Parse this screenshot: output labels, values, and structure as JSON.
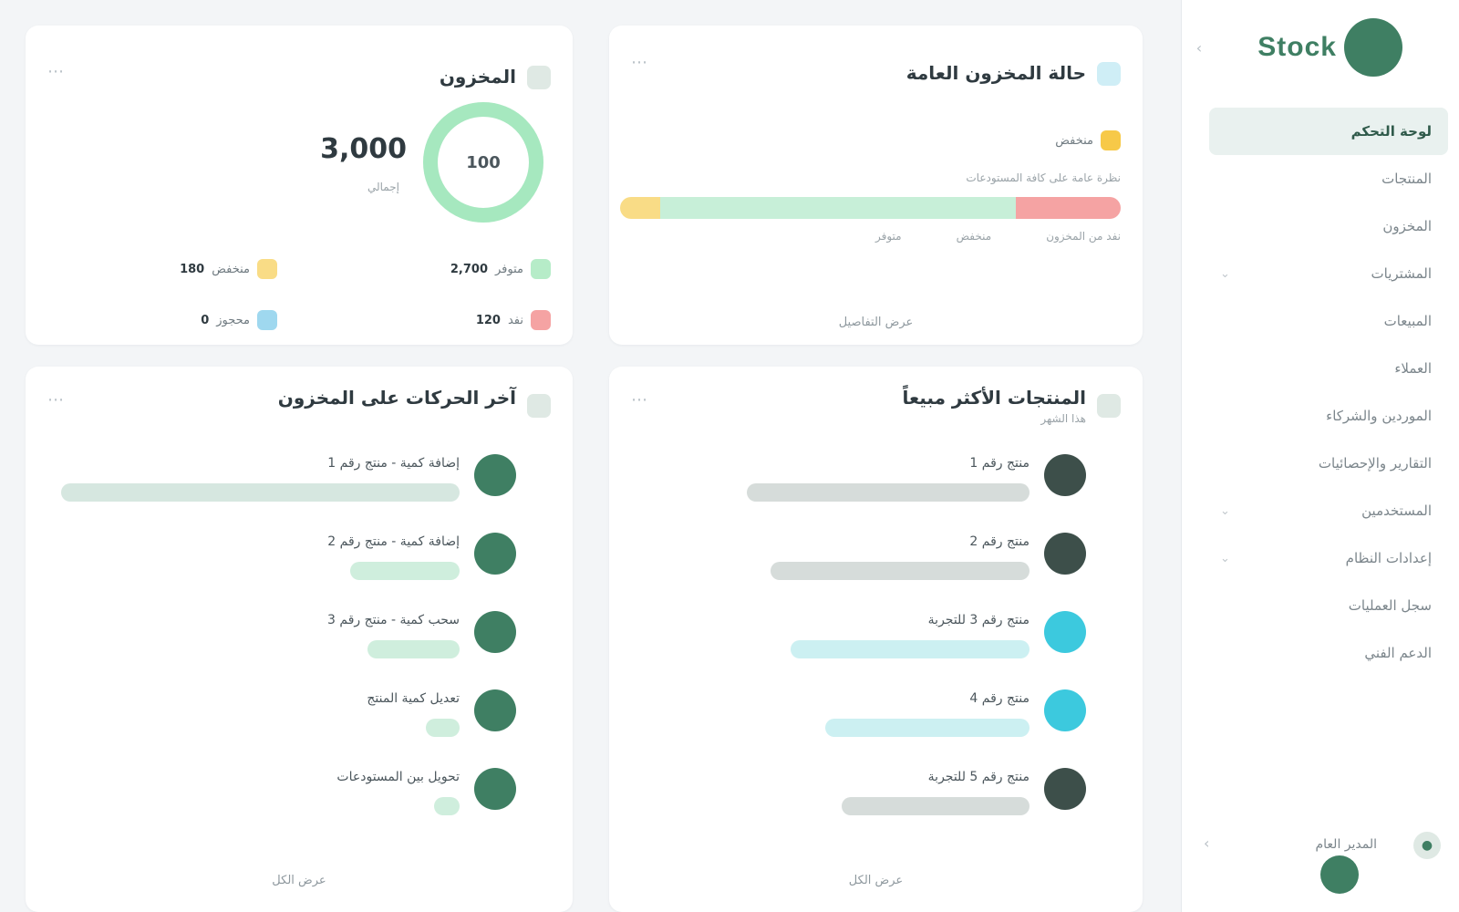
{
  "brand": {
    "name": "Stock"
  },
  "sidebar": {
    "items": [
      {
        "label": "لوحة التحكم"
      },
      {
        "label": "المنتجات"
      },
      {
        "label": "المخزون"
      },
      {
        "label": "المشتريات"
      },
      {
        "label": "المبيعات"
      },
      {
        "label": "العملاء"
      },
      {
        "label": "الموردين والشركاء"
      },
      {
        "label": "التقارير والإحصائيات"
      },
      {
        "label": "المستخدمين"
      },
      {
        "label": "إعدادات النظام"
      },
      {
        "label": "سجل العمليات"
      },
      {
        "label": "الدعم الفني"
      }
    ],
    "user": {
      "name": "المدير العام"
    }
  },
  "cards": {
    "status": {
      "title": "حالة المخزون العامة",
      "subtitle": "",
      "legend_label": "منخفض",
      "note": "نظرة عامة على كافة المستودعات",
      "segments": [
        {
          "label": "منخفض",
          "fraction": 0.08,
          "color": "#f9dc86"
        },
        {
          "label": "متوفر",
          "fraction": 0.71,
          "color": "#c7efd8"
        },
        {
          "label": "نفد",
          "fraction": 0.21,
          "color": "#f5a3a3"
        }
      ],
      "labels": [
        "متوفر",
        "منخفض",
        "نفد من المخزون"
      ],
      "footer": "عرض التفاصيل"
    },
    "stock": {
      "title": "المخزون",
      "total": "3,000",
      "total_label": "إجمالي",
      "donut_center": "100",
      "donut_color": "#a6e8bf",
      "rows": [
        {
          "label": "متوفر",
          "value": "2,700",
          "color": "#b6ecc8"
        },
        {
          "label": "منخفض",
          "value": "180",
          "color": "#f9dc86"
        },
        {
          "label": "نفد",
          "value": "120",
          "color": "#f5a3a3"
        },
        {
          "label": "محجوز",
          "value": "0",
          "color": "#9fd8ef"
        }
      ]
    },
    "top": {
      "title": "المنتجات الأكثر مبيعاً",
      "subtitle": "هذا الشهر",
      "items": [
        {
          "name": "منتج رقم 1",
          "fraction": 0.72,
          "color": "#d6dcda",
          "avatar": "#3d4f4a",
          "value": ""
        },
        {
          "name": "منتج رقم 2",
          "fraction": 0.66,
          "color": "#d6dcda",
          "avatar": "#3d4f4a",
          "value": ""
        },
        {
          "name": "منتج رقم 3 للتجربة",
          "fraction": 0.61,
          "color": "#ccf0f2",
          "avatar": "#3cc9de",
          "value": ""
        },
        {
          "name": "منتج رقم 4",
          "fraction": 0.52,
          "color": "#ccf0f2",
          "avatar": "#3cc9de",
          "value": ""
        },
        {
          "name": "منتج رقم 5 للتجربة",
          "fraction": 0.48,
          "color": "#d6dcda",
          "avatar": "#3d4f4a",
          "value": ""
        }
      ],
      "footer": "عرض الكل"
    },
    "recent": {
      "title": "آخر الحركات على المخزون",
      "subtitle": "",
      "items": [
        {
          "name": "إضافة كمية - منتج رقم 1",
          "fraction": 0.95,
          "color": "#d6e7e0",
          "avatar": "#3f7f63",
          "value": ""
        },
        {
          "name": "إضافة كمية - منتج رقم 2",
          "fraction": 0.26,
          "color": "#cfeedd",
          "avatar": "#3f7f63",
          "value": ""
        },
        {
          "name": "سحب كمية - منتج رقم 3",
          "fraction": 0.22,
          "color": "#cfeedd",
          "avatar": "#3f7f63",
          "value": ""
        },
        {
          "name": "تعديل كمية المنتج",
          "fraction": 0.08,
          "color": "#cfeedd",
          "avatar": "#3f7f63",
          "value": ""
        },
        {
          "name": "تحويل بين المستودعات",
          "fraction": 0.06,
          "color": "#cfeedd",
          "avatar": "#3f7f63",
          "value": ""
        }
      ],
      "footer": "عرض الكل"
    }
  }
}
